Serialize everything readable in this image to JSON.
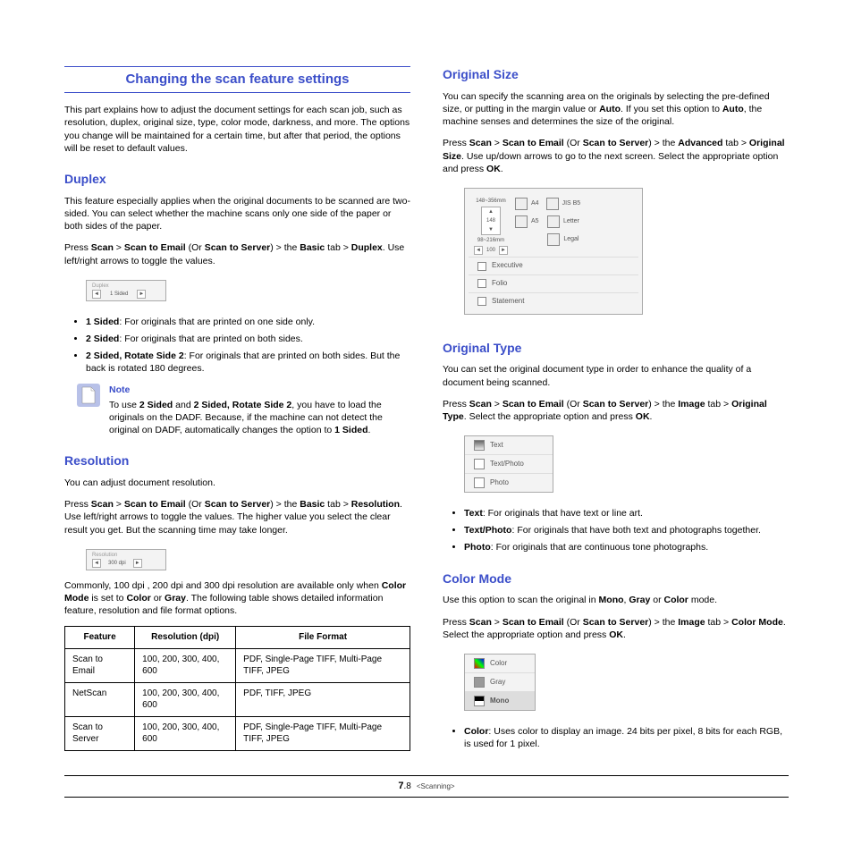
{
  "mainTitle": "Changing the scan feature settings",
  "intro": "This part explains how to adjust the document settings for each scan job, such as resolution, duplex, original size, type, color mode, darkness, and more. The options you change will be maintained for a certain time, but after that period, the options will be reset to default values.",
  "duplex": {
    "title": "Duplex",
    "p1": "This feature especially applies when the original documents to be scanned are two-sided. You can select whether the machine scans only one side of the paper or both sides of the paper.",
    "p2a": "Press ",
    "p2b": "Scan",
    "p2c": " > ",
    "p2d": "Scan to Email",
    "p2e": " (Or ",
    "p2f": "Scan to Server",
    "p2g": ") > the ",
    "p2h": "Basic",
    "p2i": " tab > ",
    "p2j": "Duplex",
    "p2k": ". Use left/right arrows to toggle the values.",
    "bullets": [
      {
        "b": "1 Sided",
        "t": ": For originals that are printed on one side only."
      },
      {
        "b": "2 Sided",
        "t": ": For originals that are printed on both sides."
      },
      {
        "b": "2 Sided, Rotate Side 2",
        "t": ": For originals that are printed on both sides. But the back is rotated 180 degrees."
      }
    ],
    "noteTitle": "Note",
    "note": "To use 2 Sided and 2 Sided, Rotate Side 2, you have to load the originals on the DADF. Because, if the machine can not detect the original on DADF, automatically changes the option to 1 Sided."
  },
  "resolution": {
    "title": "Resolution",
    "p1": "You can adjust document resolution.",
    "p2a": "Press ",
    "p2b": "Scan",
    "p2c": " > ",
    "p2d": "Scan to Email",
    "p2e": " (Or ",
    "p2f": "Scan to Server",
    "p2g": ") > the ",
    "p2h": "Basic",
    "p2i": " tab > ",
    "p2j": "Resolution",
    "p2k": ". Use left/right arrows to toggle the values. The higher value you select the clear result you get. But the scanning time may take longer.",
    "p3a": "Commonly, 100 dpi , 200 dpi and 300 dpi resolution are available only when ",
    "p3b": "Color Mode",
    "p3c": " is set to ",
    "p3d": "Color",
    "p3e": " or ",
    "p3f": "Gray",
    "p3g": ". The following table shows detailed information feature, resolution and file format options.",
    "th1": "Feature",
    "th2": "Resolution (dpi)",
    "th3": "File Format",
    "rows": [
      {
        "f": "Scan to Email",
        "r": "100, 200, 300, 400, 600",
        "ff": "PDF, Single-Page TIFF, Multi-Page TIFF, JPEG"
      },
      {
        "f": "NetScan",
        "r": "100, 200, 300, 400, 600",
        "ff": "PDF, TIFF, JPEG"
      },
      {
        "f": "Scan to Server",
        "r": "100, 200, 300, 400, 600",
        "ff": "PDF, Single-Page TIFF, Multi-Page TIFF, JPEG"
      }
    ],
    "shotLabel": "Resolution",
    "shotVal": "300 dpi"
  },
  "originalSize": {
    "title": "Original Size",
    "p1a": "You can specify the scanning area on the originals by selecting the pre-defined size, or putting in the margin value or ",
    "p1b": "Auto",
    "p1c": ". If you set this option to ",
    "p1d": "Auto",
    "p1e": ", the machine senses and determines the size of the original.",
    "p2a": "Press ",
    "p2b": "Scan",
    "p2c": " > ",
    "p2d": "Scan to Email",
    "p2e": " (Or ",
    "p2f": "Scan to Server",
    "p2g": ") > the ",
    "p2h": "Advanced",
    "p2i": " tab > ",
    "p2j": "Original Size",
    "p2k": ". Use up/down arrows to go to the next screen. Select the appropriate option and press ",
    "p2l": "OK",
    "p2m": ".",
    "sizes": {
      "a4": "A4",
      "a5": "A5",
      "jisb5": "JIS B5",
      "letter": "Letter",
      "legal": "Legal",
      "exec": "Executive",
      "folio": "Folio",
      "stmt": "Statement",
      "mmH": "148~356mm",
      "mmW": "98~216mm",
      "v1": "148",
      "v2": "100"
    }
  },
  "originalType": {
    "title": "Original Type",
    "p1": "You can set the original document type in order to enhance the quality of a document being scanned.",
    "p2a": "Press ",
    "p2b": "Scan",
    "p2c": " > ",
    "p2d": "Scan to Email",
    "p2e": " (Or ",
    "p2f": "Scan to Server",
    "p2g": ") > the ",
    "p2h": "Image",
    "p2i": " tab > ",
    "p2j": "Original Type",
    "p2k": ". Select the appropriate option and press ",
    "p2l": "OK",
    "p2m": ".",
    "opts": {
      "text": "Text",
      "tp": "Text/Photo",
      "photo": "Photo"
    },
    "bullets": [
      {
        "b": "Text",
        "t": ": For originals that have text or line art."
      },
      {
        "b": "Text/Photo",
        "t": ": For originals that have both text and photographs together."
      },
      {
        "b": "Photo",
        "t": ": For originals that are continuous tone photographs."
      }
    ]
  },
  "colorMode": {
    "title": "Color Mode",
    "p1a": "Use this option to scan the original in ",
    "p1b": "Mono",
    "p1c": ", ",
    "p1d": "Gray",
    "p1e": " or ",
    "p1f": "Color",
    "p1g": " mode.",
    "p2a": "Press ",
    "p2b": "Scan",
    "p2c": " > ",
    "p2d": "Scan to Email",
    "p2e": " (Or ",
    "p2f": "Scan to Server",
    "p2g": ") > the ",
    "p2h": "Image",
    "p2i": " tab > ",
    "p2j": "Color Mode",
    "p2k": ". Select the appropriate option and press ",
    "p2l": "OK",
    "p2m": ".",
    "opts": {
      "color": "Color",
      "gray": "Gray",
      "mono": "Mono"
    },
    "bullet": {
      "b": "Color",
      "t": ": Uses color to display an image. 24 bits per pixel, 8 bits for each RGB, is used for 1 pixel."
    }
  },
  "footer": {
    "page": "7",
    "sub": ".8",
    "section": "<Scanning>"
  }
}
